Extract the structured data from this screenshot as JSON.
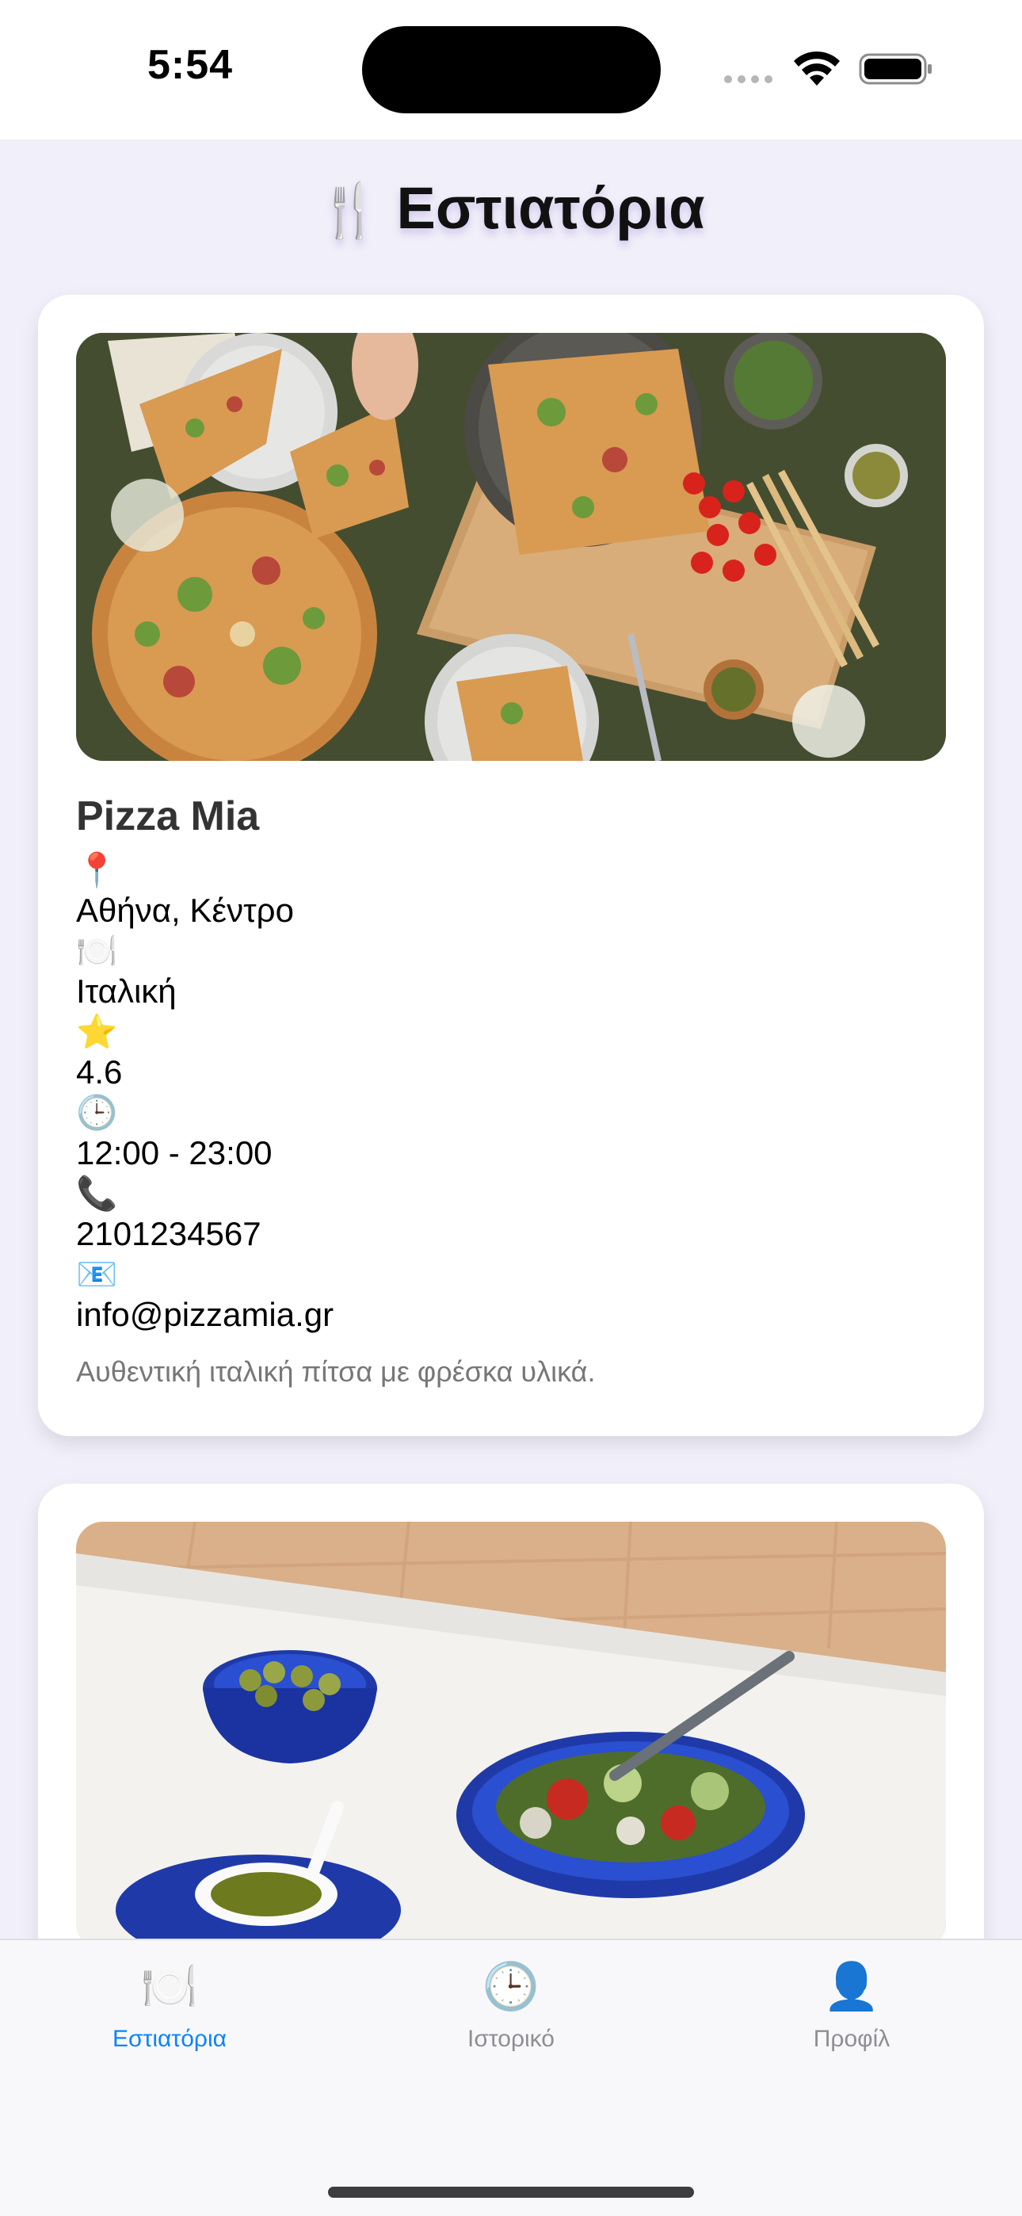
{
  "status_bar": {
    "time": "5:54"
  },
  "header": {
    "title_emoji": "🍴",
    "title": "Εστιατόρια"
  },
  "restaurants": [
    {
      "name": "Pizza Mia",
      "location_icon": "📍",
      "location": "Αθήνα, Κέντρο",
      "cuisine_icon": "🍽️",
      "cuisine": "Ιταλική",
      "rating_icon": "⭐",
      "rating": "4.6",
      "hours_icon": "🕒",
      "hours": "12:00 - 23:00",
      "phone_icon": "📞",
      "phone": "2101234567",
      "email_icon": "📧",
      "email": "info@pizzamia.gr",
      "description": "Αυθεντική ιταλική πίτσα με φρέσκα υλικά."
    }
  ],
  "tab_bar": {
    "tabs": [
      {
        "icon": "🍽️",
        "label": "Εστιατόρια",
        "active": true
      },
      {
        "icon": "🕒",
        "label": "Ιστορικό",
        "active": false
      },
      {
        "icon": "👤",
        "label": "Προφίλ",
        "active": false
      }
    ],
    "active_color": "#0a84ff",
    "inactive_color": "#8e8e93"
  }
}
